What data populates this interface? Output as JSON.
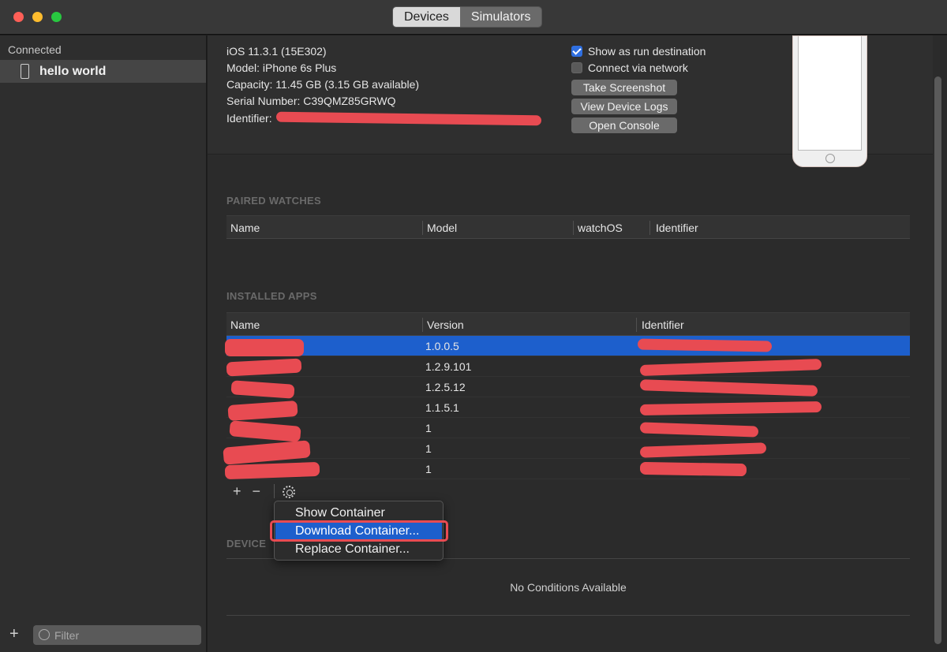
{
  "window": {
    "tabs": [
      {
        "label": "Devices",
        "active": true
      },
      {
        "label": "Simulators",
        "active": false
      }
    ]
  },
  "sidebar": {
    "heading": "Connected",
    "device": "hello world",
    "filter_placeholder": "Filter",
    "add_label": "+"
  },
  "device_info": {
    "ios": "iOS 11.3.1 (15E302)",
    "model": "Model: iPhone 6s Plus",
    "capacity": "Capacity: 11.45 GB (3.15 GB available)",
    "serial": "Serial Number: C39QMZ85GRWQ",
    "identifier_label": "Identifier:"
  },
  "options": {
    "show_as_run_destination": {
      "label": "Show as run destination",
      "checked": true
    },
    "connect_via_network": {
      "label": "Connect via network",
      "checked": false
    }
  },
  "actions": {
    "take_screenshot": "Take Screenshot",
    "view_device_logs": "View Device Logs",
    "open_console": "Open Console"
  },
  "paired_watches": {
    "title": "PAIRED WATCHES",
    "columns": [
      "Name",
      "Model",
      "watchOS",
      "Identifier"
    ]
  },
  "installed_apps": {
    "title": "INSTALLED APPS",
    "columns": [
      "Name",
      "Version",
      "Identifier"
    ],
    "rows": [
      {
        "version": "1.0.0.5",
        "selected": true
      },
      {
        "version": "1.2.9.101",
        "selected": false
      },
      {
        "version": "1.2.5.12",
        "selected": false
      },
      {
        "version": "1.1.5.1",
        "selected": false
      },
      {
        "version": "1",
        "selected": false
      },
      {
        "version": "1",
        "selected": false
      },
      {
        "version": "1",
        "selected": false
      }
    ],
    "add_label": "+",
    "remove_label": "−"
  },
  "context_menu": {
    "items": [
      "Show Container",
      "Download Container...",
      "Replace Container..."
    ],
    "selected_index": 1
  },
  "device_conditions": {
    "title": "DEVICE",
    "empty_text": "No Conditions Available"
  },
  "colors": {
    "accent": "#1d5fcc",
    "redaction": "#e84b52"
  }
}
